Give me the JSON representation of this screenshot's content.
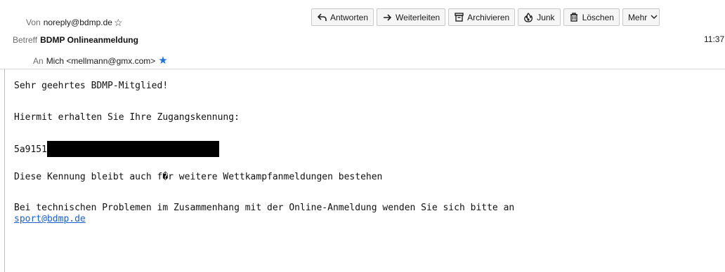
{
  "header": {
    "from_label": "Von",
    "from_value": "noreply@bdmp.de",
    "subject_label": "Betreff",
    "subject_value": "BDMP Onlineanmeldung",
    "to_label": "An",
    "to_value": "Mich <mellmann@gmx.com>",
    "time": "11:37"
  },
  "toolbar": {
    "reply_label": "Antworten",
    "forward_label": "Weiterleiten",
    "archive_label": "Archivieren",
    "junk_label": "Junk",
    "delete_label": "Löschen",
    "more_label": "Mehr"
  },
  "message": {
    "greeting": "Sehr geehrtes BDMP-Mitglied!",
    "line1": "Hiermit erhalten Sie Ihre Zugangskennung:",
    "code_visible": "5a9151",
    "line2": "Diese Kennung bleibt auch f�r weitere Wettkampfanmeldungen bestehen",
    "line3": "Bei technischen Problemen im Zusammenhang mit der Online-Anmeldung wenden Sie sich bitte an",
    "link": "sport@bdmp.de"
  },
  "colors": {
    "link": "#1a5fd0",
    "star_filled": "#1a73e8",
    "button_bg": "#f6f6f6"
  }
}
